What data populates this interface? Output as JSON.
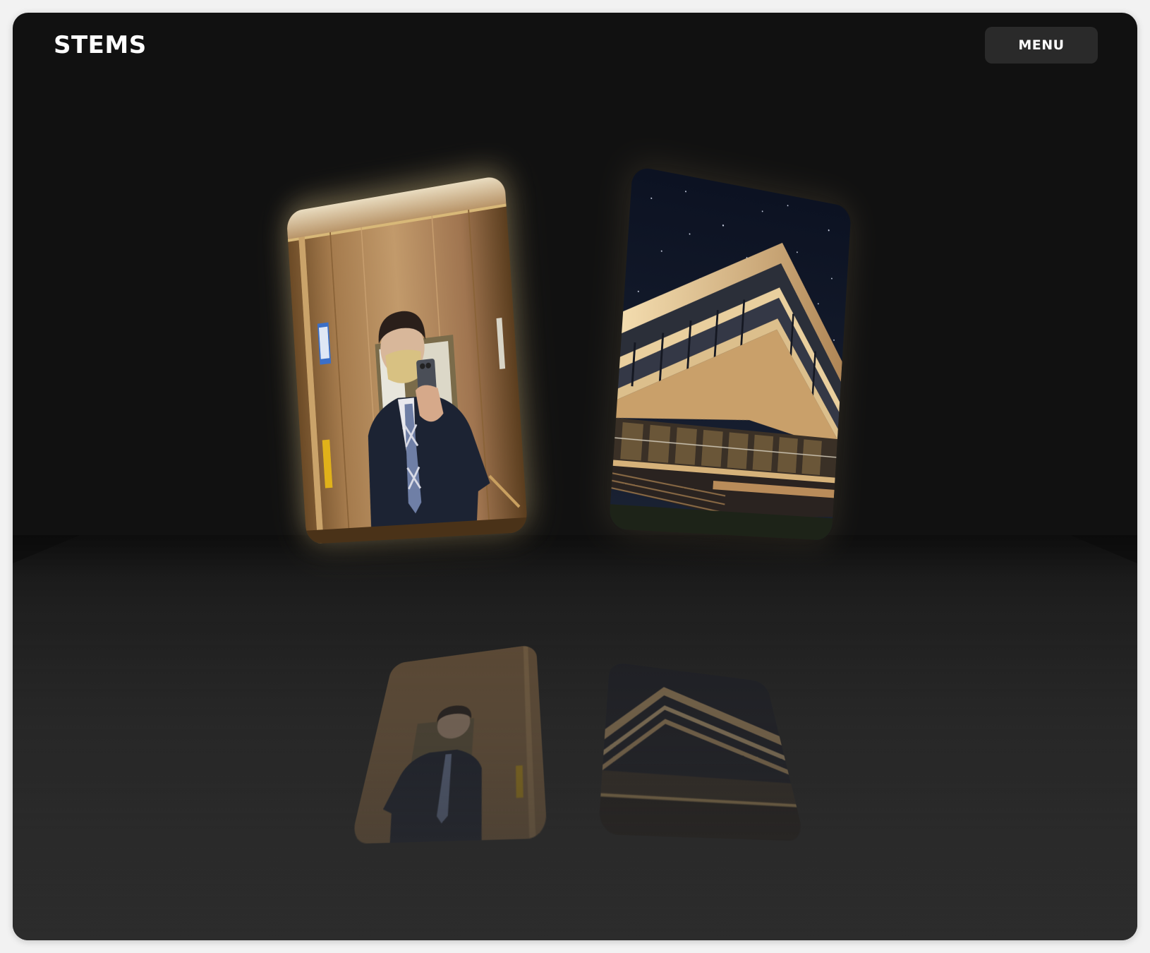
{
  "header": {
    "brand": "STEMS",
    "menu_label": "MENU"
  },
  "gallery": {
    "cards": [
      {
        "name": "elevator-selfie-photo",
        "description_icon": "photo"
      },
      {
        "name": "modern-building-night-photo",
        "description_icon": "photo"
      }
    ]
  },
  "colors": {
    "background": "#111111",
    "floor": "#2a2a2a",
    "menu_button": "#2a2a2a",
    "text": "#ffffff",
    "glow": "#f0d796"
  }
}
